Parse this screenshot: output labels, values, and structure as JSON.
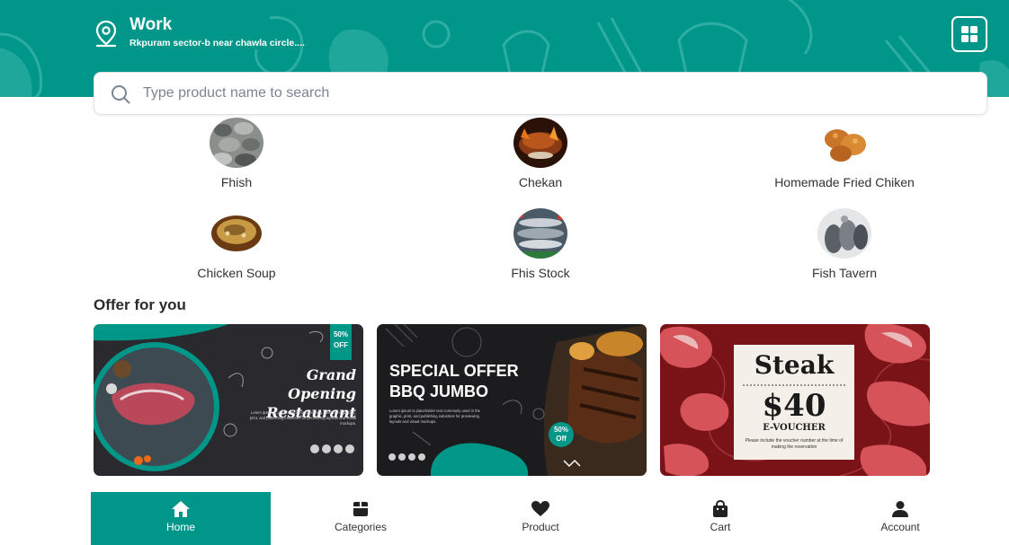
{
  "header": {
    "location_title": "Work",
    "location_address": "Rkpuram sector-b near chawla circle....",
    "brand_color": "#00978a",
    "location_icon": "map-pin-icon",
    "menu_icon": "grid-icon"
  },
  "search": {
    "placeholder": "Type product name to search",
    "value": "",
    "icon": "search-icon"
  },
  "categories": [
    {
      "label": "Fhish"
    },
    {
      "label": "Chekan"
    },
    {
      "label": "Homemade Fried Chiken"
    },
    {
      "label": "Chicken Soup"
    },
    {
      "label": "Fhis Stock"
    },
    {
      "label": "Fish Tavern"
    }
  ],
  "offers": {
    "title": "Offer for you",
    "banners": [
      {
        "badge_line1": "50%",
        "badge_line2": "OFF",
        "heading_line1": "Grand Opening",
        "heading_line2": "Restaurant",
        "body": "Lorem ipsum is placeholder text commonly used in the graphic, print, and publishing industries for previewing layouts and visual mockups."
      },
      {
        "heading_line1": "SPECIAL OFFER",
        "heading_line2": "BBQ JUMBO",
        "body": "Lorem ipsum is placeholder text commonly used in the graphic, print, and publishing industries for previewing layouts and visual mockups.",
        "badge_line1": "50%",
        "badge_line2": "Off"
      },
      {
        "heading": "Steak",
        "price": "$40",
        "subheading": "E-VOUCHER",
        "note": "Please include the voucher number at the time of making the reservation"
      }
    ]
  },
  "bottom_nav": [
    {
      "label": "Home",
      "icon": "home-icon",
      "active": true
    },
    {
      "label": "Categories",
      "icon": "box-icon",
      "active": false
    },
    {
      "label": "Product",
      "icon": "heart-icon",
      "active": false
    },
    {
      "label": "Cart",
      "icon": "bag-icon",
      "active": false
    },
    {
      "label": "Account",
      "icon": "user-icon",
      "active": false
    }
  ]
}
